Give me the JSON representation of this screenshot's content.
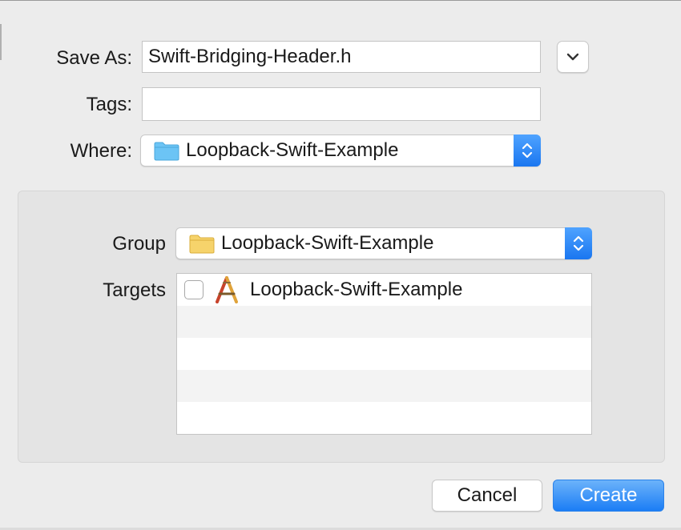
{
  "save_as": {
    "label": "Save As:",
    "value": "Swift-Bridging-Header.h"
  },
  "tags": {
    "label": "Tags:",
    "value": ""
  },
  "where": {
    "label": "Where:",
    "value": "Loopback-Swift-Example",
    "folder_icon": "folder-icon",
    "folder_color": "#6cc4f5"
  },
  "group": {
    "label": "Group",
    "value": "Loopback-Swift-Example",
    "folder_icon": "folder-icon",
    "folder_color": "#f6d36b"
  },
  "targets": {
    "label": "Targets",
    "items": [
      {
        "name": "Loopback-Swift-Example",
        "checked": false,
        "icon": "xcode-app-icon"
      }
    ]
  },
  "buttons": {
    "cancel": "Cancel",
    "create": "Create"
  },
  "colors": {
    "accent": "#1b7df5",
    "background": "#ececec",
    "panel": "#e4e4e4"
  }
}
